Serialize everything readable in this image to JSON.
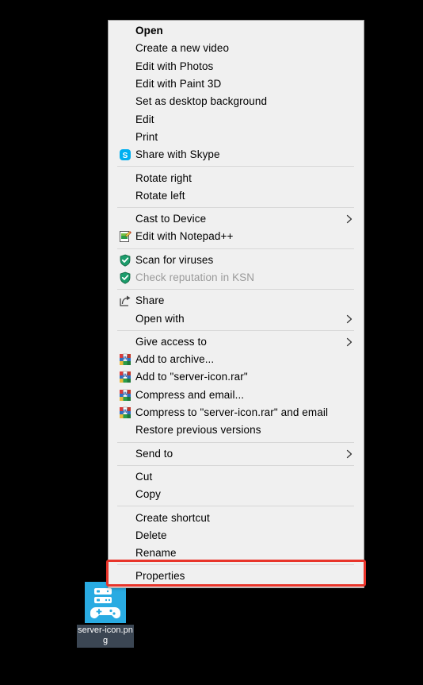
{
  "desktop": {
    "icon": {
      "name": "icon-label",
      "filename": "server-icon.png",
      "art_name": "server-gamepad-icon",
      "background_color": "#29abe2",
      "selection_color": "#3b4653"
    }
  },
  "context_menu": {
    "name": "file-context-menu",
    "background_color": "#f0f0f0",
    "border_color": "#a0a0a0",
    "items": [
      {
        "label": "Open",
        "icon": "none",
        "bold": true,
        "disabled": false,
        "submenu": false
      },
      {
        "label": "Create a new video",
        "icon": "none",
        "bold": false,
        "disabled": false,
        "submenu": false
      },
      {
        "label": "Edit with Photos",
        "icon": "none",
        "bold": false,
        "disabled": false,
        "submenu": false
      },
      {
        "label": "Edit with Paint 3D",
        "icon": "none",
        "bold": false,
        "disabled": false,
        "submenu": false
      },
      {
        "label": "Set as desktop background",
        "icon": "none",
        "bold": false,
        "disabled": false,
        "submenu": false
      },
      {
        "label": "Edit",
        "icon": "none",
        "bold": false,
        "disabled": false,
        "submenu": false
      },
      {
        "label": "Print",
        "icon": "none",
        "bold": false,
        "disabled": false,
        "submenu": false
      },
      {
        "label": "Share with Skype",
        "icon": "skype-icon",
        "bold": false,
        "disabled": false,
        "submenu": false
      },
      {
        "separator": true
      },
      {
        "label": "Rotate right",
        "icon": "none",
        "bold": false,
        "disabled": false,
        "submenu": false
      },
      {
        "label": "Rotate left",
        "icon": "none",
        "bold": false,
        "disabled": false,
        "submenu": false
      },
      {
        "separator": true
      },
      {
        "label": "Cast to Device",
        "icon": "none",
        "bold": false,
        "disabled": false,
        "submenu": true
      },
      {
        "label": "Edit with Notepad++",
        "icon": "notepadpp-icon",
        "bold": false,
        "disabled": false,
        "submenu": false
      },
      {
        "separator": true
      },
      {
        "label": "Scan for viruses",
        "icon": "shield-icon",
        "bold": false,
        "disabled": false,
        "submenu": false
      },
      {
        "label": "Check reputation in KSN",
        "icon": "shield-icon",
        "bold": false,
        "disabled": true,
        "submenu": false
      },
      {
        "separator": true
      },
      {
        "label": "Share",
        "icon": "share-icon",
        "bold": false,
        "disabled": false,
        "submenu": false
      },
      {
        "label": "Open with",
        "icon": "none",
        "bold": false,
        "disabled": false,
        "submenu": true
      },
      {
        "separator": true
      },
      {
        "label": "Give access to",
        "icon": "none",
        "bold": false,
        "disabled": false,
        "submenu": true
      },
      {
        "label": "Add to archive...",
        "icon": "winrar-icon",
        "bold": false,
        "disabled": false,
        "submenu": false
      },
      {
        "label": "Add to \"server-icon.rar\"",
        "icon": "winrar-icon",
        "bold": false,
        "disabled": false,
        "submenu": false
      },
      {
        "label": "Compress and email...",
        "icon": "winrar-icon",
        "bold": false,
        "disabled": false,
        "submenu": false
      },
      {
        "label": "Compress to \"server-icon.rar\" and email",
        "icon": "winrar-icon",
        "bold": false,
        "disabled": false,
        "submenu": false
      },
      {
        "label": "Restore previous versions",
        "icon": "none",
        "bold": false,
        "disabled": false,
        "submenu": false
      },
      {
        "separator": true
      },
      {
        "label": "Send to",
        "icon": "none",
        "bold": false,
        "disabled": false,
        "submenu": true
      },
      {
        "separator": true
      },
      {
        "label": "Cut",
        "icon": "none",
        "bold": false,
        "disabled": false,
        "submenu": false
      },
      {
        "label": "Copy",
        "icon": "none",
        "bold": false,
        "disabled": false,
        "submenu": false
      },
      {
        "separator": true
      },
      {
        "label": "Create shortcut",
        "icon": "none",
        "bold": false,
        "disabled": false,
        "submenu": false
      },
      {
        "label": "Delete",
        "icon": "none",
        "bold": false,
        "disabled": false,
        "submenu": false
      },
      {
        "label": "Rename",
        "icon": "none",
        "bold": false,
        "disabled": false,
        "submenu": false
      },
      {
        "separator": true
      },
      {
        "label": "Properties",
        "icon": "none",
        "bold": false,
        "disabled": false,
        "submenu": false,
        "highlighted": true
      }
    ]
  },
  "annotation": {
    "name": "properties-highlight",
    "color": "#e8342a",
    "target_label": "Properties"
  }
}
